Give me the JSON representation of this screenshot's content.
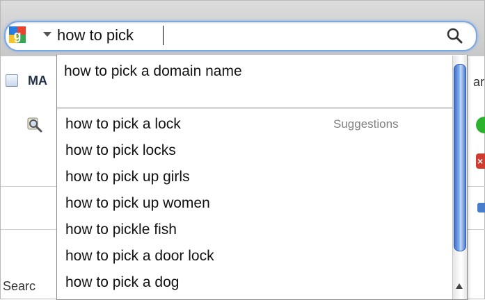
{
  "search": {
    "query": "how to pick",
    "engine_icon": "google-logo-icon",
    "submit_icon": "search-icon"
  },
  "background": {
    "label_ma": "MA",
    "text_ar": "ar",
    "text_search": "Searc"
  },
  "dropdown": {
    "history": [
      {
        "label": "how to pick a domain name"
      }
    ],
    "section_label": "Suggestions",
    "suggestions": [
      {
        "label": "how to pick a lock"
      },
      {
        "label": "how to pick locks"
      },
      {
        "label": "how to pick up girls"
      },
      {
        "label": "how to pick up women"
      },
      {
        "label": "how to pickle fish"
      },
      {
        "label": "how to pick a door lock"
      },
      {
        "label": "how to pick a dog"
      }
    ]
  },
  "colors": {
    "focus_ring": "#7aa7df",
    "scroll_thumb": "#4a79d2",
    "section_label": "#808080"
  }
}
